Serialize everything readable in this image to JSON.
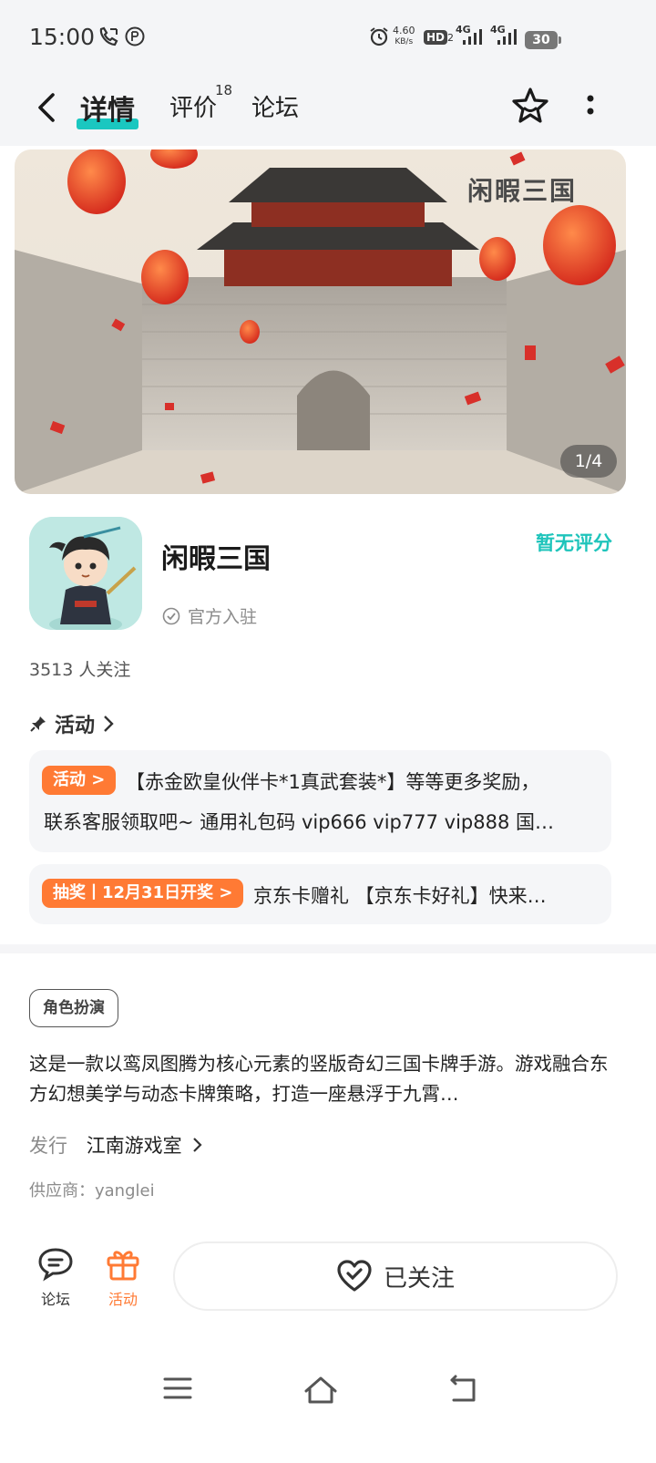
{
  "status_bar": {
    "time": "15:00",
    "net_speed_value": "4.60",
    "net_speed_unit": "KB/s",
    "hd_label": "HD",
    "hd_sub": "2",
    "signal1": "4G",
    "signal2": "4G",
    "battery": "30"
  },
  "nav": {
    "tabs": [
      {
        "label": "详情",
        "active": true
      },
      {
        "label": "评价",
        "badge": "18"
      },
      {
        "label": "论坛"
      }
    ]
  },
  "banner": {
    "logo_text": "闲暇三国",
    "counter": "1/4"
  },
  "app": {
    "name": "闲暇三国",
    "official_label": "官方入驻",
    "rating": "暂无评分",
    "followers": "3513 人关注"
  },
  "activity": {
    "heading": "活动",
    "cards": [
      {
        "tag": "活动 >",
        "line1": "【赤金欧皇伙伴卡*1真武套装*】等等更多奖励，",
        "line2": "联系客服领取吧~ 通用礼包码 vip666 vip777 vip888 国…"
      },
      {
        "tag": "抽奖丨12月31日开奖 >",
        "line": "京东卡赠礼 【京东卡好礼】快来…"
      }
    ]
  },
  "details": {
    "genre": "角色扮演",
    "description": "这是一款以鸾凤图腾为核心元素的竖版奇幻三国卡牌手游。游戏融合东方幻想美学与动态卡牌策略，打造一座悬浮于九霄…",
    "publisher_label": "发行",
    "publisher": "江南游戏室",
    "supplier": "供应商：yanglei"
  },
  "bottom_bar": {
    "forum_label": "论坛",
    "activity_label": "活动",
    "follow_label": "已关注"
  },
  "colors": {
    "accent_teal": "#1ac7c0",
    "accent_orange": "#ff7a34"
  }
}
